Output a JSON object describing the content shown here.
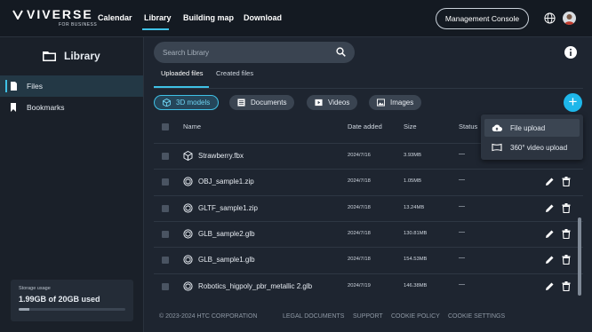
{
  "brand": {
    "name": "VIVERSE",
    "sub": "FOR BUSINESS"
  },
  "nav": {
    "items": [
      "Calendar",
      "Library",
      "Building map",
      "Download"
    ],
    "active": "Library"
  },
  "header": {
    "console_label": "Management Console"
  },
  "sidebar": {
    "title": "Library",
    "items": [
      {
        "label": "Files",
        "icon": "file-icon",
        "active": true
      },
      {
        "label": "Bookmarks",
        "icon": "bookmark-icon",
        "active": false
      }
    ],
    "storage": {
      "label": "Storage usage",
      "value": "1.99GB of 20GB used",
      "fraction": 0.0995
    }
  },
  "search": {
    "placeholder": "Search Library"
  },
  "tabs": [
    {
      "label": "Uploaded files",
      "active": true
    },
    {
      "label": "Created files",
      "active": false
    }
  ],
  "filters": [
    {
      "label": "3D models",
      "icon": "cube-icon",
      "active": true
    },
    {
      "label": "Documents",
      "icon": "document-icon",
      "active": false
    },
    {
      "label": "Videos",
      "icon": "video-icon",
      "active": false
    },
    {
      "label": "Images",
      "icon": "image-icon",
      "active": false
    }
  ],
  "add_menu": [
    {
      "label": "File upload",
      "icon": "cloud-upload-icon"
    },
    {
      "label": "360° video upload",
      "icon": "panorama-icon"
    }
  ],
  "table": {
    "columns": {
      "name": "Name",
      "date": "Date added",
      "size": "Size",
      "status": "Status"
    },
    "rows": [
      {
        "name": "Strawberry.fbx",
        "date": "2024/7/16",
        "size": "3.93MB",
        "status": "—",
        "icon": "box-icon"
      },
      {
        "name": "OBJ_sample1.zip",
        "date": "2024/7/18",
        "size": "1.05MB",
        "status": "—",
        "icon": "model-icon"
      },
      {
        "name": "GLTF_sample1.zip",
        "date": "2024/7/18",
        "size": "13.24MB",
        "status": "—",
        "icon": "model-icon"
      },
      {
        "name": "GLB_sample2.glb",
        "date": "2024/7/18",
        "size": "130.81MB",
        "status": "—",
        "icon": "model-icon"
      },
      {
        "name": "GLB_sample1.glb",
        "date": "2024/7/18",
        "size": "154.53MB",
        "status": "—",
        "icon": "model-icon"
      },
      {
        "name": "Robotics_higpoly_pbr_metallic 2.glb",
        "date": "2024/7/19",
        "size": "146.38MB",
        "status": "—",
        "icon": "model-icon"
      }
    ]
  },
  "footer": {
    "copyright": "© 2023-2024 HTC CORPORATION",
    "links": [
      "LEGAL DOCUMENTS",
      "SUPPORT",
      "COOKIE POLICY",
      "COOKIE SETTINGS"
    ]
  },
  "colors": {
    "accent": "#3fc1e6",
    "add_button": "#1eb7ea",
    "background": "#1e2530"
  }
}
